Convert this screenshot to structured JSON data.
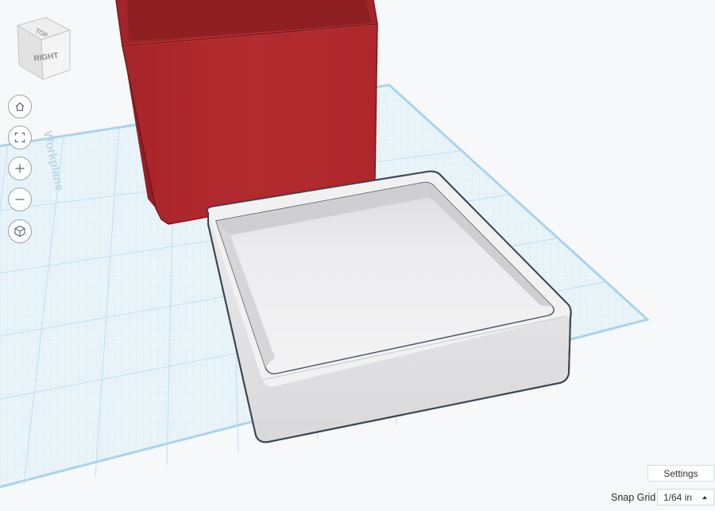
{
  "workplane": {
    "label": "Workplane"
  },
  "view_cube": {
    "top_label": "TOP",
    "right_label": "RIGHT"
  },
  "nav": {
    "home": "home-icon",
    "fit": "fit-view-icon",
    "zoom_in": "plus-icon",
    "zoom_out": "minus-icon",
    "perspective": "perspective-cube-icon"
  },
  "settings": {
    "label": "Settings"
  },
  "snap_grid": {
    "label": "Snap Grid",
    "value": "1/64 in"
  },
  "colors": {
    "red_box": "#b02a2e",
    "tray": "#e7e7e9",
    "grid_line": "#bfe1ef",
    "grid_border": "#a9d3ea",
    "background": "#f7f8f9"
  }
}
